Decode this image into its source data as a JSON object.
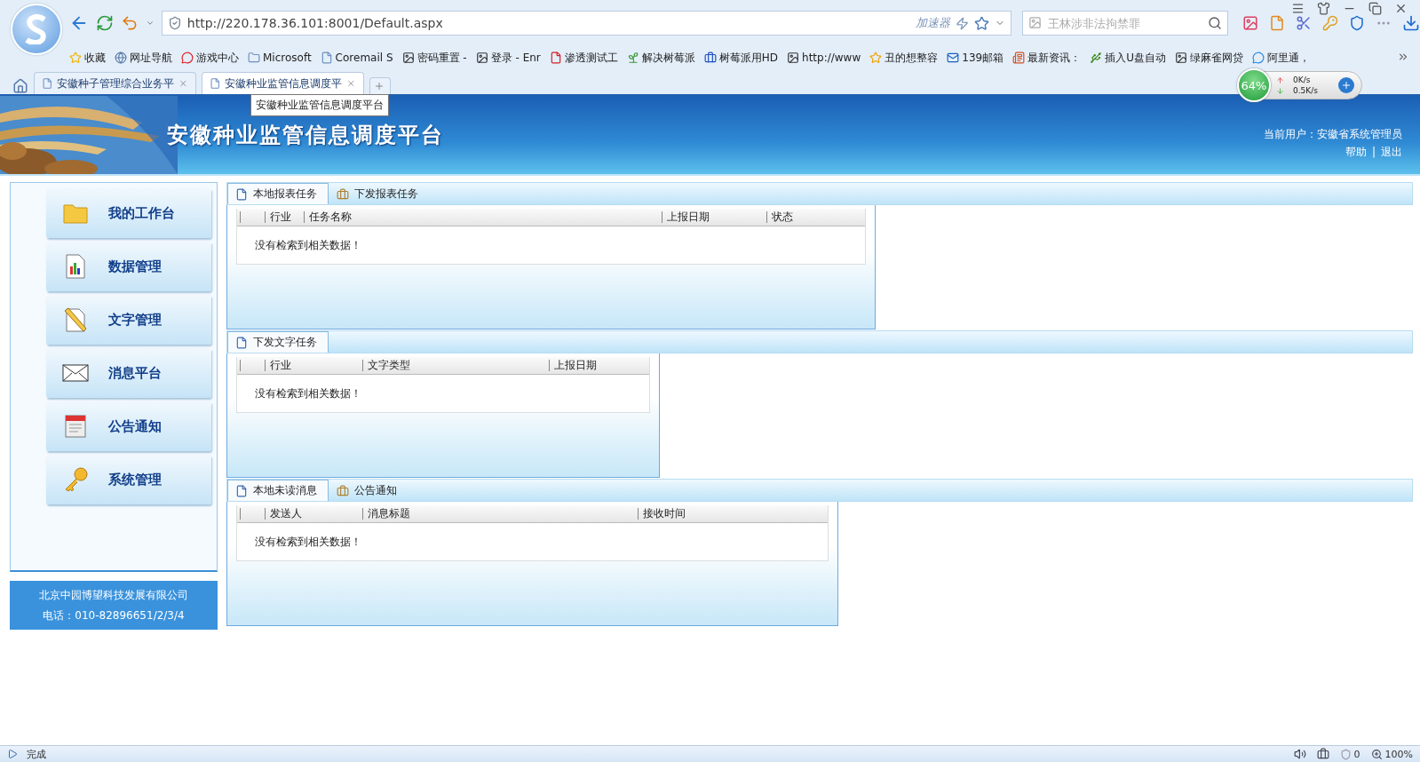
{
  "toolbar": {
    "address": "http://220.178.36.101:8001/Default.aspx",
    "accelerator": "加速器",
    "search": {
      "placeholder": "王林涉非法拘禁罪"
    }
  },
  "bookmarks": [
    {
      "label": "收藏"
    },
    {
      "label": "网址导航"
    },
    {
      "label": "游戏中心"
    },
    {
      "label": "Microsoft"
    },
    {
      "label": "Coremail S"
    },
    {
      "label": "密码重置 -"
    },
    {
      "label": "登录 - Enr"
    },
    {
      "label": "渗透测试工"
    },
    {
      "label": "解决树莓派"
    },
    {
      "label": "树莓派用HD"
    },
    {
      "label": "http://www"
    },
    {
      "label": "丑的想整容"
    },
    {
      "label": "139邮箱"
    },
    {
      "label": "最新资讯："
    },
    {
      "label": "插入U盘自动"
    },
    {
      "label": "绿麻雀网贷"
    },
    {
      "label": "阿里通，"
    }
  ],
  "tabs": [
    {
      "label": "安徽种子管理综合业务平",
      "selected": false
    },
    {
      "label": "安徽种业监管信息调度平",
      "selected": true
    }
  ],
  "tooltip": "安徽种业监管信息调度平台",
  "speed_widget": {
    "percent": "64%",
    "upload": "0K/s",
    "download": "0.5K/s"
  },
  "header": {
    "title": "安徽种业监管信息调度平台",
    "current_user": "当前用户：安徽省系统管理员",
    "links": [
      "帮助",
      "退出"
    ],
    "separator": "|"
  },
  "sidebar": {
    "items": [
      {
        "label": "我的工作台"
      },
      {
        "label": "数据管理"
      },
      {
        "label": "文字管理"
      },
      {
        "label": "消息平台"
      },
      {
        "label": "公告通知"
      },
      {
        "label": "系统管理"
      }
    ],
    "footer": {
      "company": "北京中园博望科技发展有限公司",
      "phone": "电话：010-82896651/2/3/4"
    }
  },
  "panels": [
    {
      "tabs": [
        {
          "label": "本地报表任务",
          "selected": true
        },
        {
          "label": "下发报表任务",
          "selected": false
        }
      ],
      "columns": [
        "行业",
        "任务名称",
        "上报日期",
        "状态"
      ],
      "empty": "没有检索到相关数据！"
    },
    {
      "tabs": [
        {
          "label": "下发文字任务",
          "selected": true
        }
      ],
      "columns": [
        "行业",
        "文字类型",
        "上报日期"
      ],
      "empty": "没有检索到相关数据！"
    },
    {
      "tabs": [
        {
          "label": "本地未读消息",
          "selected": true
        },
        {
          "label": "公告通知",
          "selected": false
        }
      ],
      "columns": [
        "发送人",
        "消息标题",
        "接收时间"
      ],
      "empty": "没有检索到相关数据！"
    }
  ],
  "status_bar": {
    "text": "完成",
    "blocked": "0",
    "zoom": "100%"
  }
}
